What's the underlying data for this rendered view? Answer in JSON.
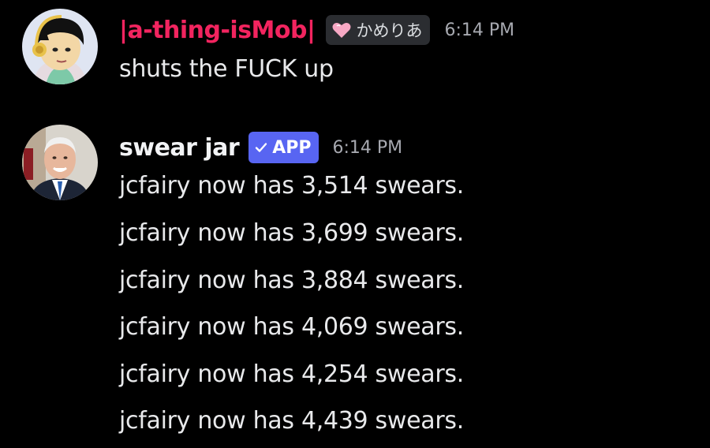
{
  "messages": [
    {
      "author": "|a-thing-isMob|",
      "server_tag": "かめりあ",
      "timestamp": "6:14 PM",
      "lines": [
        "shuts the FUCK up"
      ],
      "username_color": "#f2245f"
    },
    {
      "author": "swear jar",
      "badge": "APP",
      "timestamp": "6:14 PM",
      "lines": [
        "jcfairy now has 3,514 swears.",
        "jcfairy now has 3,699 swears.",
        "jcfairy now has 3,884 swears.",
        "jcfairy now has 4,069 swears.",
        "jcfairy now has 4,254 swears.",
        "jcfairy now has 4,439 swears."
      ],
      "username_color": "#f2f3f5",
      "badge_color": "#5865f2"
    }
  ],
  "icons": {
    "tag_icon": "heart-icon",
    "badge_icon": "check-icon"
  },
  "colors": {
    "background": "#000000",
    "timestamp": "#a7a9b0",
    "tag_background": "#2b2d31"
  }
}
